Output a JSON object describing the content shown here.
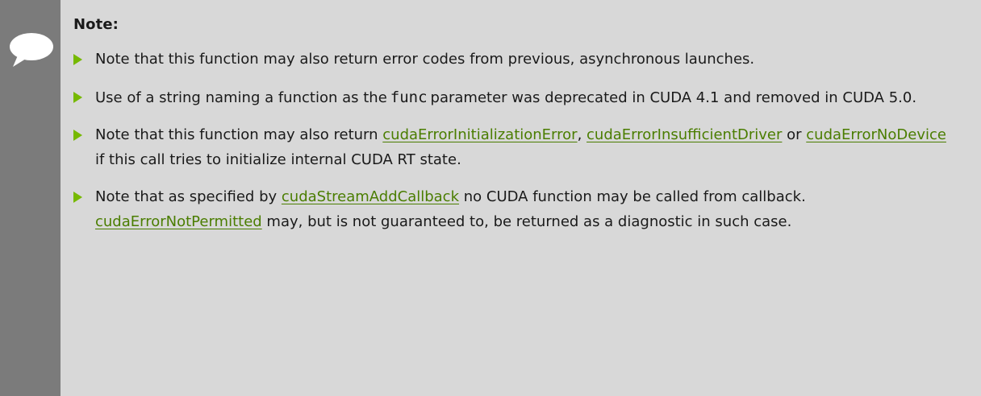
{
  "note": {
    "title": "Note:",
    "icon": "speech-bubble-icon",
    "bullet_color": "#76b900",
    "link_color": "#4a7d00",
    "items": [
      {
        "text": "Note that this function may also return error codes from previous, asynchronous launches."
      },
      {
        "text_before": "Use of a string naming a function as the",
        "code": "func",
        "text_after": "parameter was deprecated in CUDA 4.1 and removed in CUDA 5.0."
      },
      {
        "text_before": "Note that this function may also return",
        "link1": "cudaErrorInitializationError",
        "sep1": ",",
        "link2": "cudaErrorInsufficientDriver",
        "sep2": " or ",
        "link3": "cudaErrorNoDevice",
        "text_after": " if this call tries to initialize internal CUDA RT state."
      },
      {
        "text_before": "Note that as specified by",
        "link1": "cudaStreamAddCallback",
        "text_middle": " no CUDA function may be called from callback.",
        "link2": "cudaErrorNotPermitted",
        "text_after": " may, but is not guaranteed to, be returned as a diagnostic in such case."
      }
    ]
  }
}
